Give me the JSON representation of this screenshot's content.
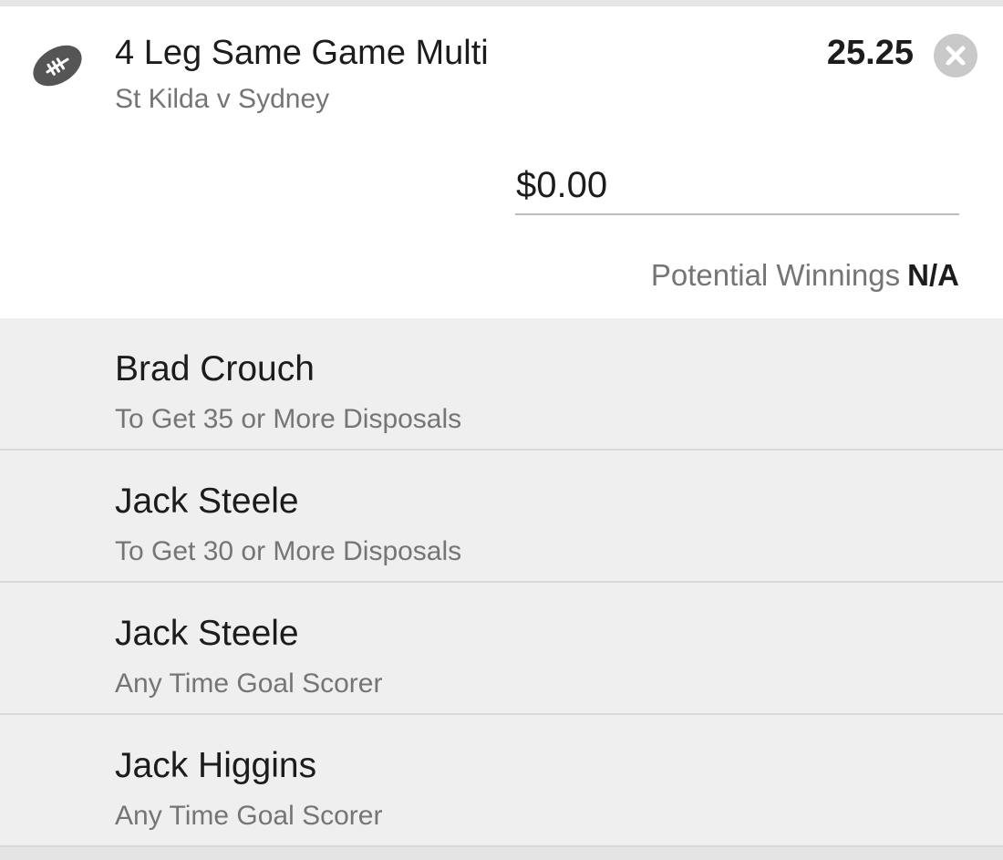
{
  "bet": {
    "icon": "football-icon",
    "title": "4 Leg Same Game Multi",
    "match": "St Kilda v Sydney",
    "odds": "25.25",
    "remove_icon": "close-icon",
    "stake_value": "$0.00",
    "winnings_label": "Potential Winnings",
    "winnings_value": "N/A"
  },
  "legs": [
    {
      "player": "Brad Crouch",
      "market": "To Get 35 or More Disposals"
    },
    {
      "player": "Jack Steele",
      "market": "To Get 30 or More Disposals"
    },
    {
      "player": "Jack Steele",
      "market": "Any Time Goal Scorer"
    },
    {
      "player": "Jack Higgins",
      "market": "Any Time Goal Scorer"
    }
  ],
  "colors": {
    "icon": "#555555",
    "title_text": "#1c1c1c",
    "secondary_text": "#757575",
    "leg_background": "#efefef",
    "remove_button": "#c9c9c9"
  }
}
